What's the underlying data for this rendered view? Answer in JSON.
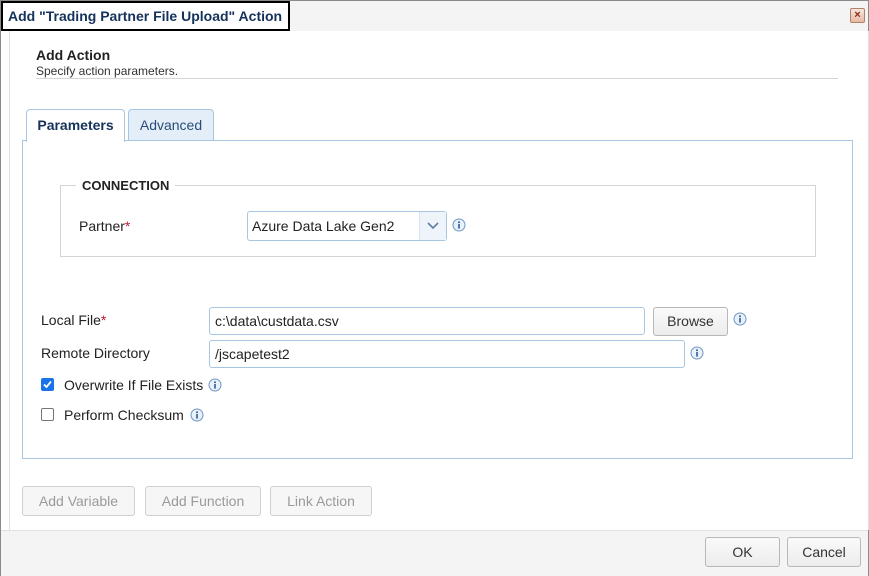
{
  "window": {
    "title": "Add \"Trading Partner File Upload\" Action",
    "close_icon": "close-icon"
  },
  "header": {
    "title": "Add Action",
    "subtitle": "Specify action parameters."
  },
  "tabs": [
    {
      "label": "Parameters",
      "active": true
    },
    {
      "label": "Advanced",
      "active": false
    }
  ],
  "connection": {
    "legend": "CONNECTION",
    "partner_label": "Partner",
    "required_mark": "*",
    "partner_value": "Azure Data Lake Gen2"
  },
  "fields": {
    "local_file_label": "Local File",
    "local_file_value": "c:\\data\\custdata.csv",
    "browse_label": "Browse",
    "remote_dir_label": "Remote Directory",
    "remote_dir_value": "/jscapetest2",
    "overwrite_label": "Overwrite If File Exists",
    "overwrite_checked": true,
    "checksum_label": "Perform Checksum",
    "checksum_checked": false
  },
  "toolbar": {
    "add_variable": "Add Variable",
    "add_function": "Add Function",
    "link_action": "Link Action"
  },
  "footer": {
    "ok": "OK",
    "cancel": "Cancel"
  },
  "colors": {
    "accent": "#1a73e8",
    "title": "#15325b",
    "required": "#c0182a",
    "border": "#a9c6e0"
  }
}
